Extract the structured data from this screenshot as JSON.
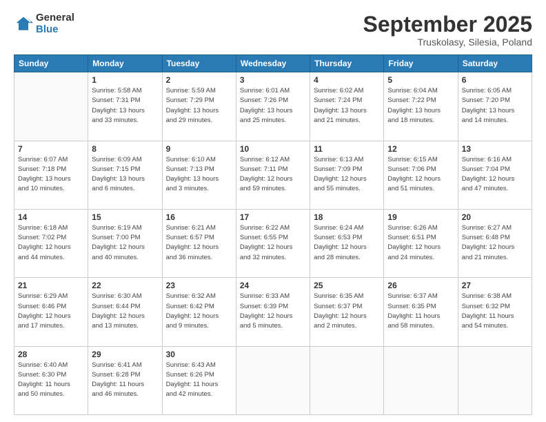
{
  "header": {
    "logo_general": "General",
    "logo_blue": "Blue",
    "month_title": "September 2025",
    "subtitle": "Truskolasy, Silesia, Poland"
  },
  "days_of_week": [
    "Sunday",
    "Monday",
    "Tuesday",
    "Wednesday",
    "Thursday",
    "Friday",
    "Saturday"
  ],
  "weeks": [
    [
      {
        "num": "",
        "info": ""
      },
      {
        "num": "1",
        "info": "Sunrise: 5:58 AM\nSunset: 7:31 PM\nDaylight: 13 hours\nand 33 minutes."
      },
      {
        "num": "2",
        "info": "Sunrise: 5:59 AM\nSunset: 7:29 PM\nDaylight: 13 hours\nand 29 minutes."
      },
      {
        "num": "3",
        "info": "Sunrise: 6:01 AM\nSunset: 7:26 PM\nDaylight: 13 hours\nand 25 minutes."
      },
      {
        "num": "4",
        "info": "Sunrise: 6:02 AM\nSunset: 7:24 PM\nDaylight: 13 hours\nand 21 minutes."
      },
      {
        "num": "5",
        "info": "Sunrise: 6:04 AM\nSunset: 7:22 PM\nDaylight: 13 hours\nand 18 minutes."
      },
      {
        "num": "6",
        "info": "Sunrise: 6:05 AM\nSunset: 7:20 PM\nDaylight: 13 hours\nand 14 minutes."
      }
    ],
    [
      {
        "num": "7",
        "info": "Sunrise: 6:07 AM\nSunset: 7:18 PM\nDaylight: 13 hours\nand 10 minutes."
      },
      {
        "num": "8",
        "info": "Sunrise: 6:09 AM\nSunset: 7:15 PM\nDaylight: 13 hours\nand 6 minutes."
      },
      {
        "num": "9",
        "info": "Sunrise: 6:10 AM\nSunset: 7:13 PM\nDaylight: 13 hours\nand 3 minutes."
      },
      {
        "num": "10",
        "info": "Sunrise: 6:12 AM\nSunset: 7:11 PM\nDaylight: 12 hours\nand 59 minutes."
      },
      {
        "num": "11",
        "info": "Sunrise: 6:13 AM\nSunset: 7:09 PM\nDaylight: 12 hours\nand 55 minutes."
      },
      {
        "num": "12",
        "info": "Sunrise: 6:15 AM\nSunset: 7:06 PM\nDaylight: 12 hours\nand 51 minutes."
      },
      {
        "num": "13",
        "info": "Sunrise: 6:16 AM\nSunset: 7:04 PM\nDaylight: 12 hours\nand 47 minutes."
      }
    ],
    [
      {
        "num": "14",
        "info": "Sunrise: 6:18 AM\nSunset: 7:02 PM\nDaylight: 12 hours\nand 44 minutes."
      },
      {
        "num": "15",
        "info": "Sunrise: 6:19 AM\nSunset: 7:00 PM\nDaylight: 12 hours\nand 40 minutes."
      },
      {
        "num": "16",
        "info": "Sunrise: 6:21 AM\nSunset: 6:57 PM\nDaylight: 12 hours\nand 36 minutes."
      },
      {
        "num": "17",
        "info": "Sunrise: 6:22 AM\nSunset: 6:55 PM\nDaylight: 12 hours\nand 32 minutes."
      },
      {
        "num": "18",
        "info": "Sunrise: 6:24 AM\nSunset: 6:53 PM\nDaylight: 12 hours\nand 28 minutes."
      },
      {
        "num": "19",
        "info": "Sunrise: 6:26 AM\nSunset: 6:51 PM\nDaylight: 12 hours\nand 24 minutes."
      },
      {
        "num": "20",
        "info": "Sunrise: 6:27 AM\nSunset: 6:48 PM\nDaylight: 12 hours\nand 21 minutes."
      }
    ],
    [
      {
        "num": "21",
        "info": "Sunrise: 6:29 AM\nSunset: 6:46 PM\nDaylight: 12 hours\nand 17 minutes."
      },
      {
        "num": "22",
        "info": "Sunrise: 6:30 AM\nSunset: 6:44 PM\nDaylight: 12 hours\nand 13 minutes."
      },
      {
        "num": "23",
        "info": "Sunrise: 6:32 AM\nSunset: 6:42 PM\nDaylight: 12 hours\nand 9 minutes."
      },
      {
        "num": "24",
        "info": "Sunrise: 6:33 AM\nSunset: 6:39 PM\nDaylight: 12 hours\nand 5 minutes."
      },
      {
        "num": "25",
        "info": "Sunrise: 6:35 AM\nSunset: 6:37 PM\nDaylight: 12 hours\nand 2 minutes."
      },
      {
        "num": "26",
        "info": "Sunrise: 6:37 AM\nSunset: 6:35 PM\nDaylight: 11 hours\nand 58 minutes."
      },
      {
        "num": "27",
        "info": "Sunrise: 6:38 AM\nSunset: 6:32 PM\nDaylight: 11 hours\nand 54 minutes."
      }
    ],
    [
      {
        "num": "28",
        "info": "Sunrise: 6:40 AM\nSunset: 6:30 PM\nDaylight: 11 hours\nand 50 minutes."
      },
      {
        "num": "29",
        "info": "Sunrise: 6:41 AM\nSunset: 6:28 PM\nDaylight: 11 hours\nand 46 minutes."
      },
      {
        "num": "30",
        "info": "Sunrise: 6:43 AM\nSunset: 6:26 PM\nDaylight: 11 hours\nand 42 minutes."
      },
      {
        "num": "",
        "info": ""
      },
      {
        "num": "",
        "info": ""
      },
      {
        "num": "",
        "info": ""
      },
      {
        "num": "",
        "info": ""
      }
    ]
  ]
}
